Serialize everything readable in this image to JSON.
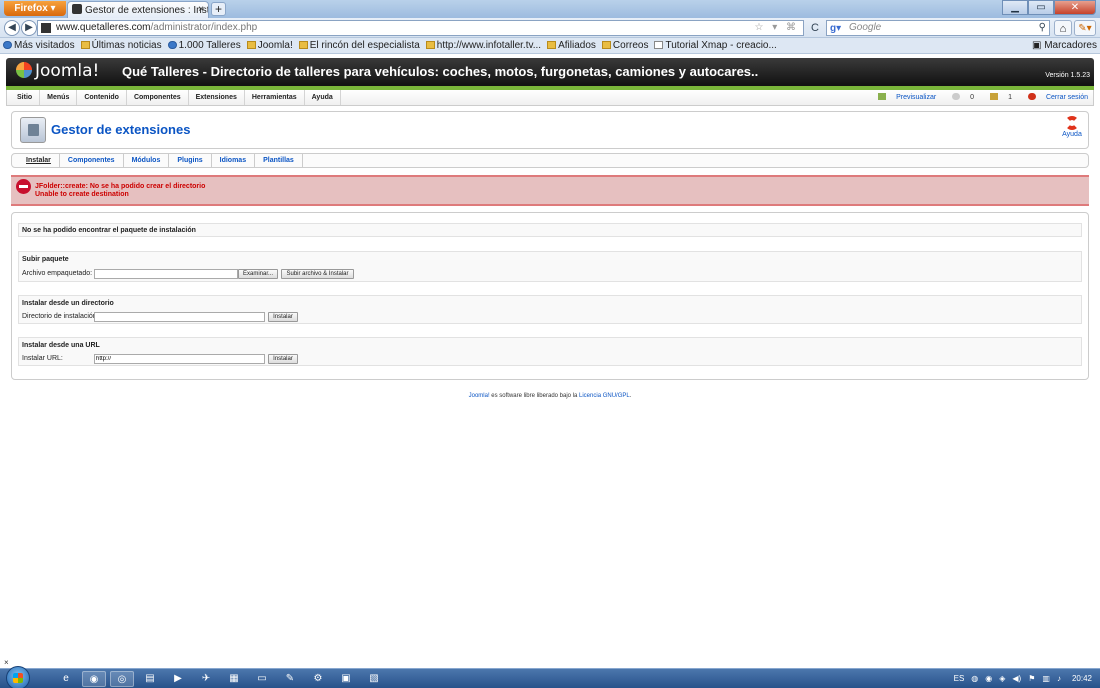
{
  "browser": {
    "app_button": "Firefox",
    "tab_title": "Gestor de extensiones : Instalar",
    "tab_close": "×",
    "new_tab": "+",
    "url_domain": "www.quetalleres.com",
    "url_path": "/administrator/index.php",
    "search_placeholder": "Google",
    "back": "◀",
    "forward": "▶",
    "reload": "C",
    "home": "⌂",
    "bookmarks": [
      {
        "label": "Más visitados",
        "icon": "rss"
      },
      {
        "label": "Últimas noticias",
        "icon": "folder"
      },
      {
        "label": "1.000 Talleres",
        "icon": "rss"
      },
      {
        "label": "Joomla!",
        "icon": "folder"
      },
      {
        "label": "El rincón del especialista",
        "icon": "folder"
      },
      {
        "label": "http://www.infotaller.tv...",
        "icon": "folder"
      },
      {
        "label": "Afiliados",
        "icon": "folder"
      },
      {
        "label": "Correos",
        "icon": "folder"
      },
      {
        "label": "Tutorial Xmap - creacio...",
        "icon": "page"
      }
    ],
    "bookmarks_menu": "Marcadores"
  },
  "joomla": {
    "logo_text": "Joomla!",
    "site_title": "Qué Talleres - Directorio de talleres para vehículos: coches, motos, furgonetas, camiones y autocares..",
    "version": "Versión 1.5.23",
    "menu": [
      "Sitio",
      "Menús",
      "Contenido",
      "Componentes",
      "Extensiones",
      "Herramientas",
      "Ayuda"
    ],
    "status": {
      "preview": "Previsualizar",
      "messages_count": "0",
      "users_count": "1",
      "logout": "Cerrar sesión"
    },
    "page_title": "Gestor de extensiones",
    "help_label": "Ayuda",
    "subnav": [
      "Instalar",
      "Componentes",
      "Módulos",
      "Plugins",
      "Idiomas",
      "Plantillas"
    ],
    "errors": [
      "JFolder::create: No se ha podido crear el directorio",
      "Unable to create destination"
    ],
    "no_package": "No se ha podido encontrar el paquete de instalación",
    "upload": {
      "heading": "Subir paquete",
      "label": "Archivo empaquetado:",
      "browse": "Examinar...",
      "submit": "Subir archivo & Instalar"
    },
    "directory": {
      "heading": "Instalar desde un directorio",
      "label": "Directorio de instalación:",
      "value": "",
      "submit": "Instalar"
    },
    "url": {
      "heading": "Instalar desde una URL",
      "label": "Instalar URL:",
      "value": "http://",
      "submit": "Instalar"
    },
    "footer": {
      "link1": "Joomla!",
      "middle": " es software libre liberado bajo la ",
      "link2": "Licencia GNU/GPL",
      "end": "."
    }
  },
  "taskbar": {
    "language": "ES",
    "clock": "20:42"
  }
}
